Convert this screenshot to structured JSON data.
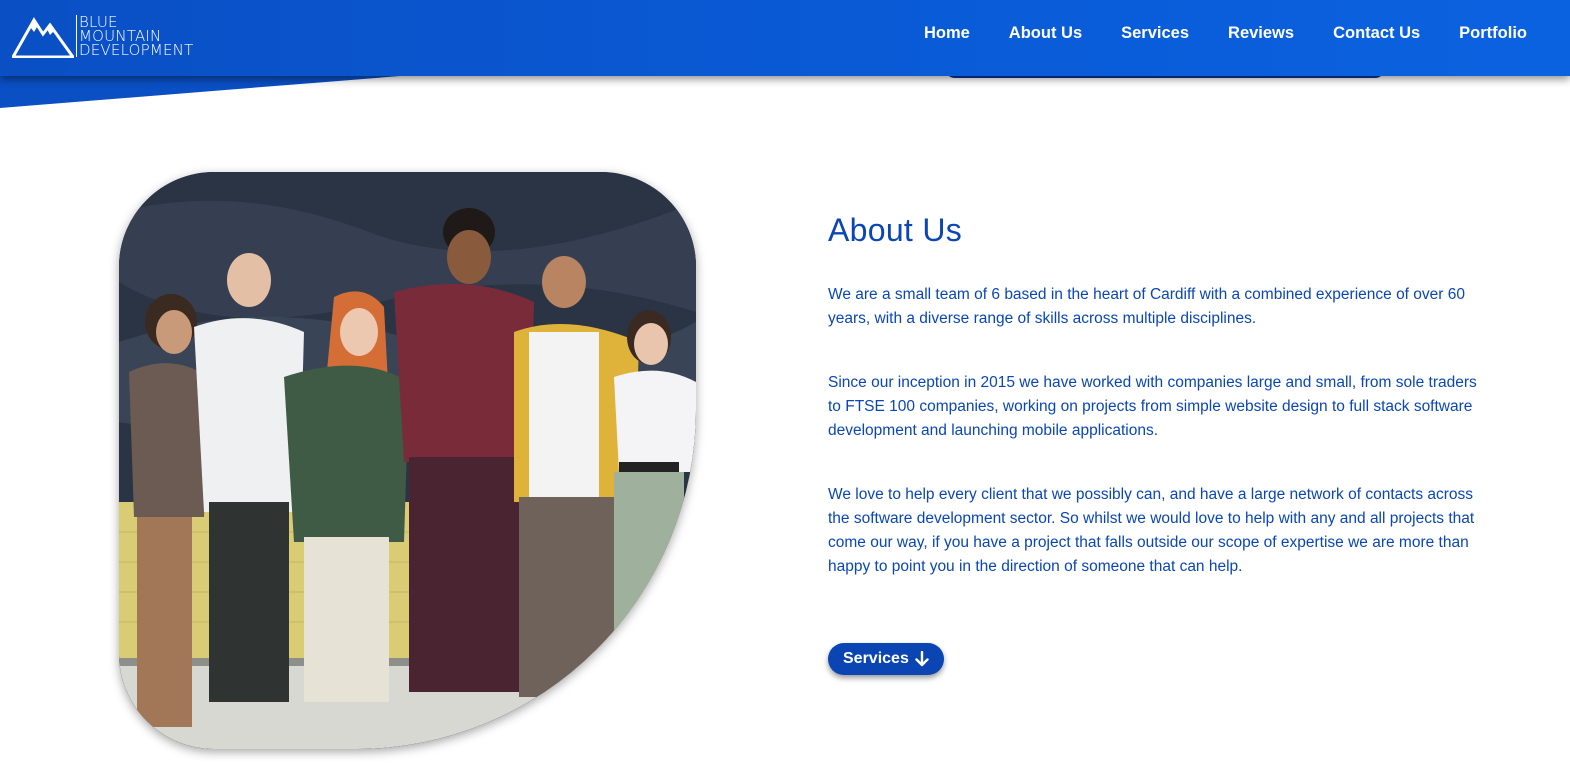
{
  "brand": {
    "lines": [
      "BLUE",
      "MOUNTAIN",
      "DEVELOPMENT"
    ],
    "logo_icon": "mountain-icon"
  },
  "nav": {
    "items": [
      {
        "label": "Home"
      },
      {
        "label": "About Us"
      },
      {
        "label": "Services"
      },
      {
        "label": "Reviews"
      },
      {
        "label": "Contact Us"
      },
      {
        "label": "Portfolio"
      }
    ]
  },
  "about": {
    "title": "About Us",
    "paragraphs": [
      "We are a small team of 6 based in the heart of Cardiff with a combined experience of over 60 years, with a diverse range of skills across multiple disciplines.",
      "Since our inception in 2015 we have worked with companies large and small, from sole traders to FTSE 100 companies, working on projects from simple website design to full stack software development and launching mobile applications.",
      "We love to help every client that we possibly can, and have a large network of contacts across the software development sector. So whilst we would love to help with any and all projects that come our way, if you have a project that falls outside our scope of expertise we are more than happy to point you in the direction of someone that can help."
    ],
    "button_label": "Services",
    "button_icon": "arrow-down-icon",
    "image_icon": "team-photo"
  },
  "colors": {
    "brand_blue": "#0a52cc",
    "text_blue": "#0a46b5",
    "button_blue": "#0a45b3"
  }
}
